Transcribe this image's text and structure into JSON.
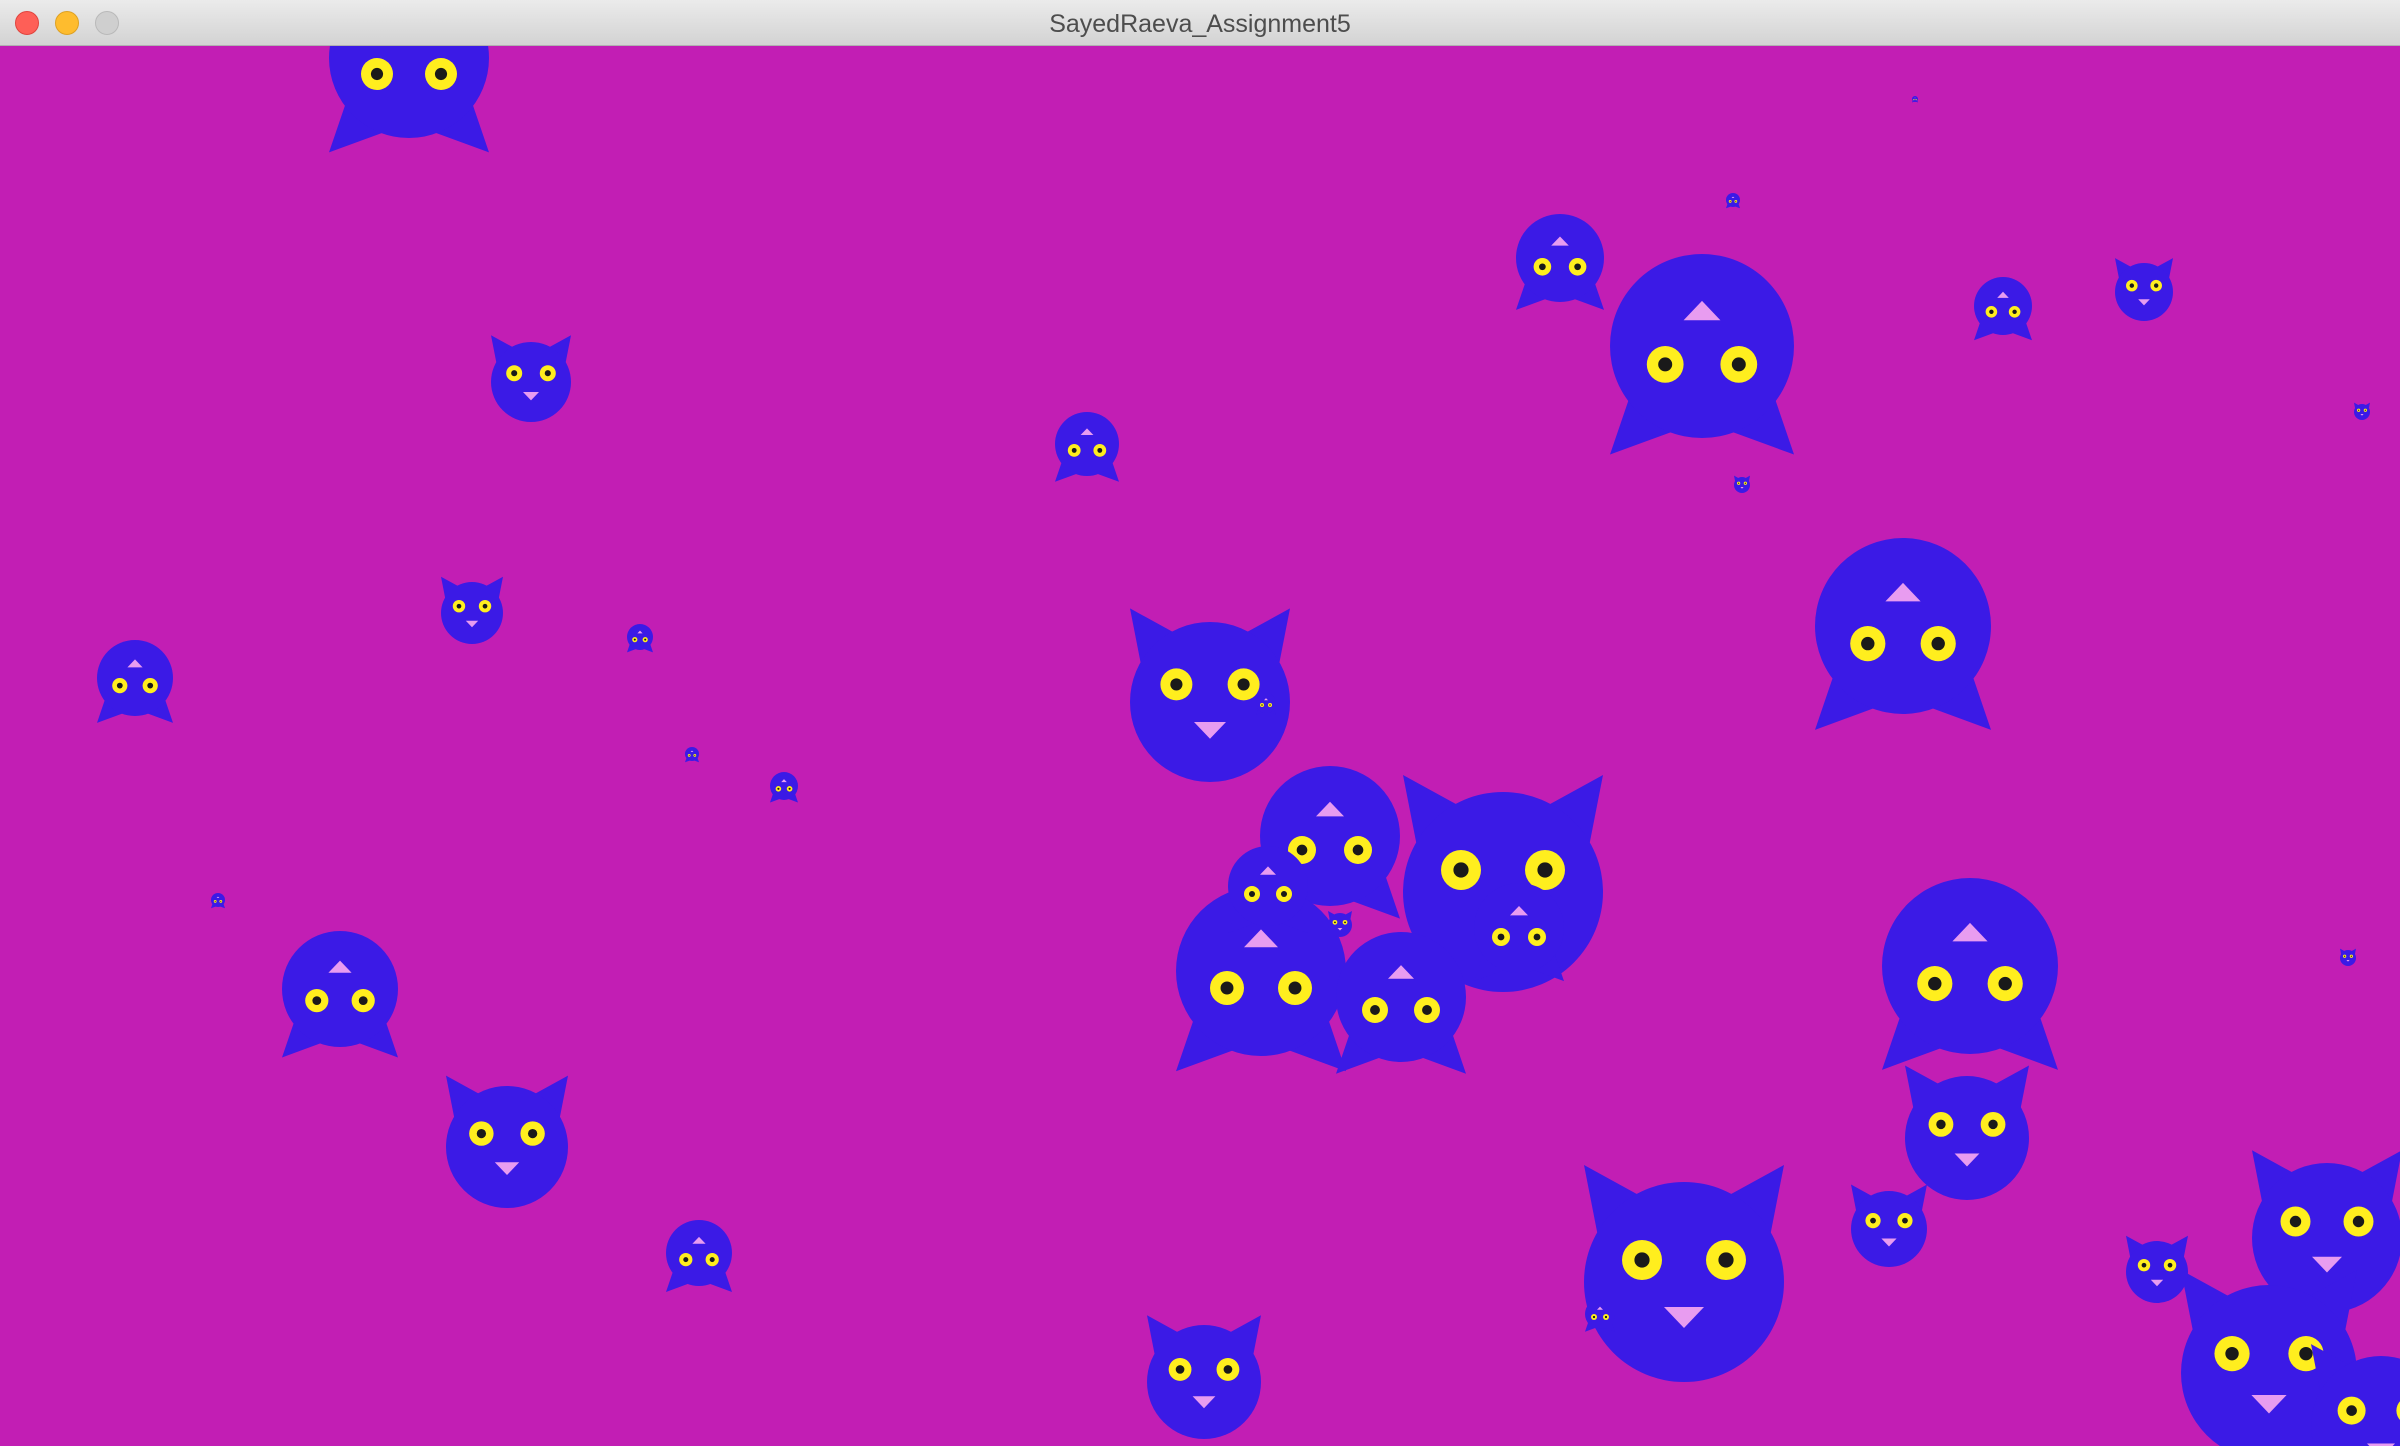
{
  "window": {
    "title": "SayedRaeva_Assignment5"
  },
  "colors": {
    "background": "#c21eb4",
    "creature_body": "#3b1ae6",
    "eye": "#ffee1e",
    "pupil": "#1a1a1a",
    "nose": "#e89cf0"
  },
  "icons": {
    "close": "close-icon",
    "minimize": "minimize-icon",
    "zoom": "zoom-icon"
  }
}
